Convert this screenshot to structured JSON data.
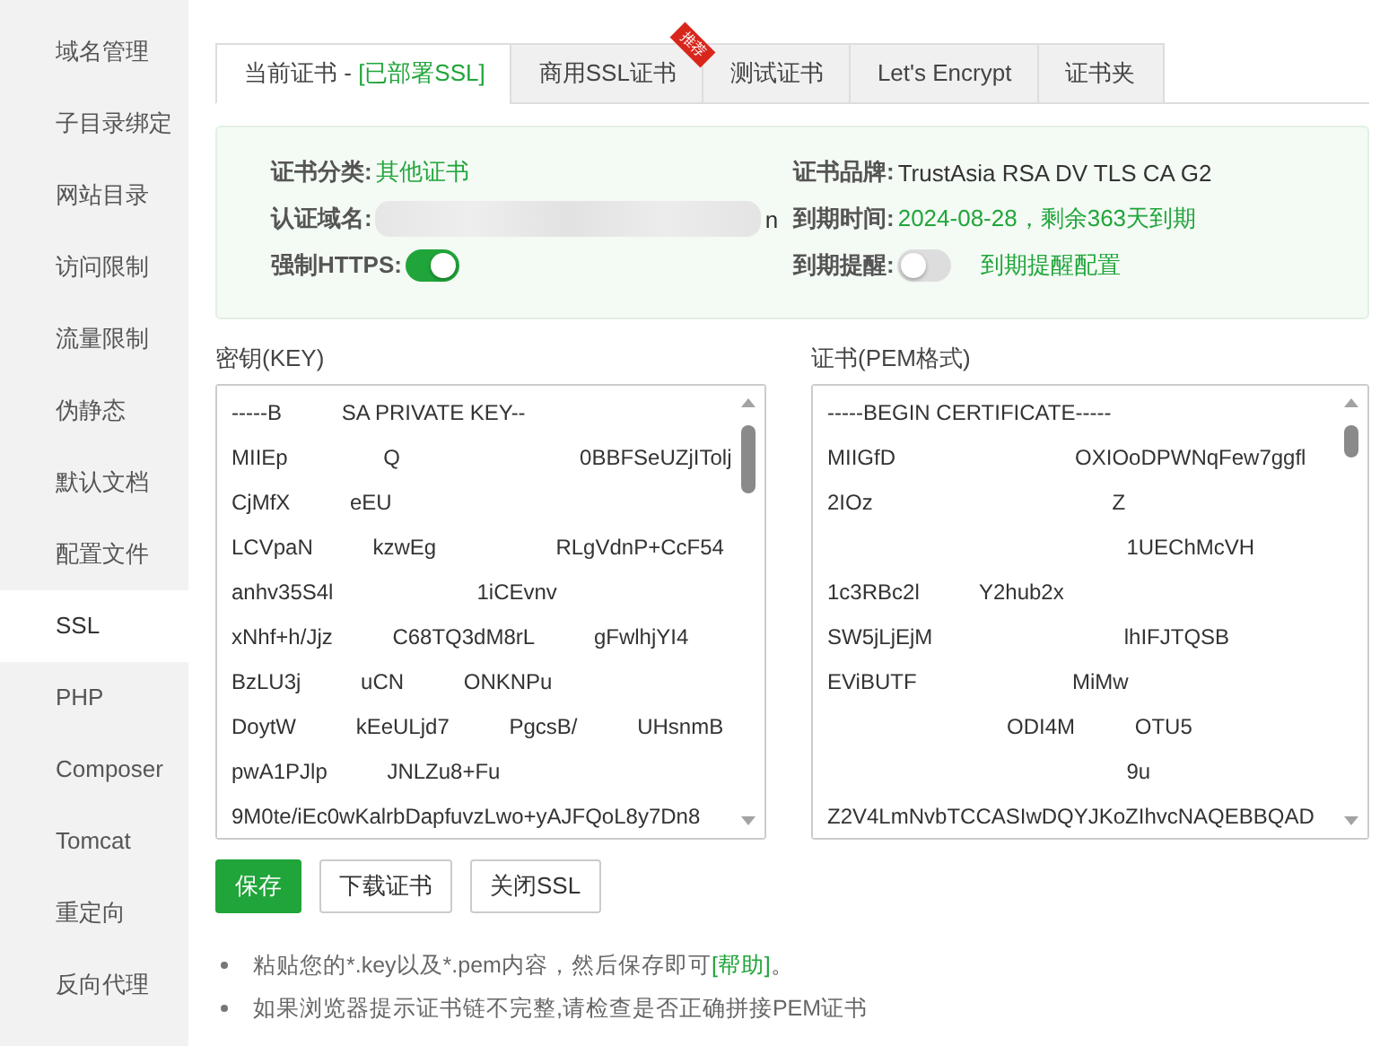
{
  "sidebar": {
    "items": [
      {
        "label": "域名管理",
        "selected": false
      },
      {
        "label": "子目录绑定",
        "selected": false
      },
      {
        "label": "网站目录",
        "selected": false
      },
      {
        "label": "访问限制",
        "selected": false
      },
      {
        "label": "流量限制",
        "selected": false
      },
      {
        "label": "伪静态",
        "selected": false
      },
      {
        "label": "默认文档",
        "selected": false
      },
      {
        "label": "配置文件",
        "selected": false
      },
      {
        "label": "SSL",
        "selected": true
      },
      {
        "label": "PHP",
        "selected": false
      },
      {
        "label": "Composer",
        "selected": false
      },
      {
        "label": "Tomcat",
        "selected": false
      },
      {
        "label": "重定向",
        "selected": false
      },
      {
        "label": "反向代理",
        "selected": false
      }
    ]
  },
  "tabs": [
    {
      "label": "当前证书 - ",
      "status": "[已部署SSL]",
      "selected": true
    },
    {
      "label": "商用SSL证书",
      "badge": "推荐",
      "selected": false
    },
    {
      "label": "测试证书",
      "selected": false
    },
    {
      "label": "Let's Encrypt",
      "selected": false
    },
    {
      "label": "证书夹",
      "selected": false
    }
  ],
  "info": {
    "left": [
      {
        "kind": "text",
        "label": "证书分类:",
        "value": "其他证书"
      },
      {
        "kind": "redacted",
        "label": "认证域名:",
        "value": "n"
      },
      {
        "kind": "toggle",
        "label": "强制HTTPS:",
        "on": true
      }
    ],
    "right": [
      {
        "kind": "plain",
        "label": "证书品牌:",
        "value": "TrustAsia RSA DV TLS CA G2"
      },
      {
        "kind": "text",
        "label": "到期时间:",
        "value": "2024-08-28，剩余363天到期"
      },
      {
        "kind": "toggle",
        "label": "到期提醒:",
        "on": false,
        "link": "到期提醒配置"
      }
    ]
  },
  "key_field": {
    "label": "密钥(KEY)",
    "lines": [
      "-----B          SA PRIVATE KEY--",
      "MIIEp                Q                              0BBFSeUZjITolj",
      "CjMfX          eEU",
      "LCVpaN          kzwEg                    RLgVdnP+CcF54",
      "anhv35S4l                        1iCEvnv",
      "xNhf+h/Jjz          C68TQ3dM8rL          gFwlhjYI4",
      "BzLU3j          uCN          ONKNPu",
      "DoytW          kEeULjd7          PgcsB/          UHsnmB",
      "pwA1PJlp          JNLZu8+Fu",
      "9M0te/iEc0wKalrbDapfuvzLwo+yAJFQoL8y7Dn8"
    ]
  },
  "cert_field": {
    "label": "证书(PEM格式)",
    "lines": [
      "-----BEGIN CERTIFICATE-----",
      "MIIGfD                              OXIOoDPWNqFew7ggfl",
      "2IOz                                        Z",
      "                                                  1UEChMcVH",
      "1c3RBc2l          Y2hub2x",
      "SW5jLjEjM                                lhIFJTQSB",
      "EViBUTF                          MiMw",
      "                              ODI4M          OTU5",
      "                                                  9u",
      "Z2V4LmNvbTCCASIwDQYJKoZIhvcNAQEBBQAD"
    ]
  },
  "buttons": [
    {
      "label": "保存",
      "kind": "primary"
    },
    {
      "label": "下载证书",
      "kind": "default"
    },
    {
      "label": "关闭SSL",
      "kind": "default"
    }
  ],
  "notes": [
    {
      "text": "粘贴您的*.key以及*.pem内容，然后保存即可",
      "link": "[帮助]",
      "after": "。"
    },
    {
      "text": "如果浏览器提示证书链不完整,请检查是否正确拼接PEM证书"
    }
  ]
}
